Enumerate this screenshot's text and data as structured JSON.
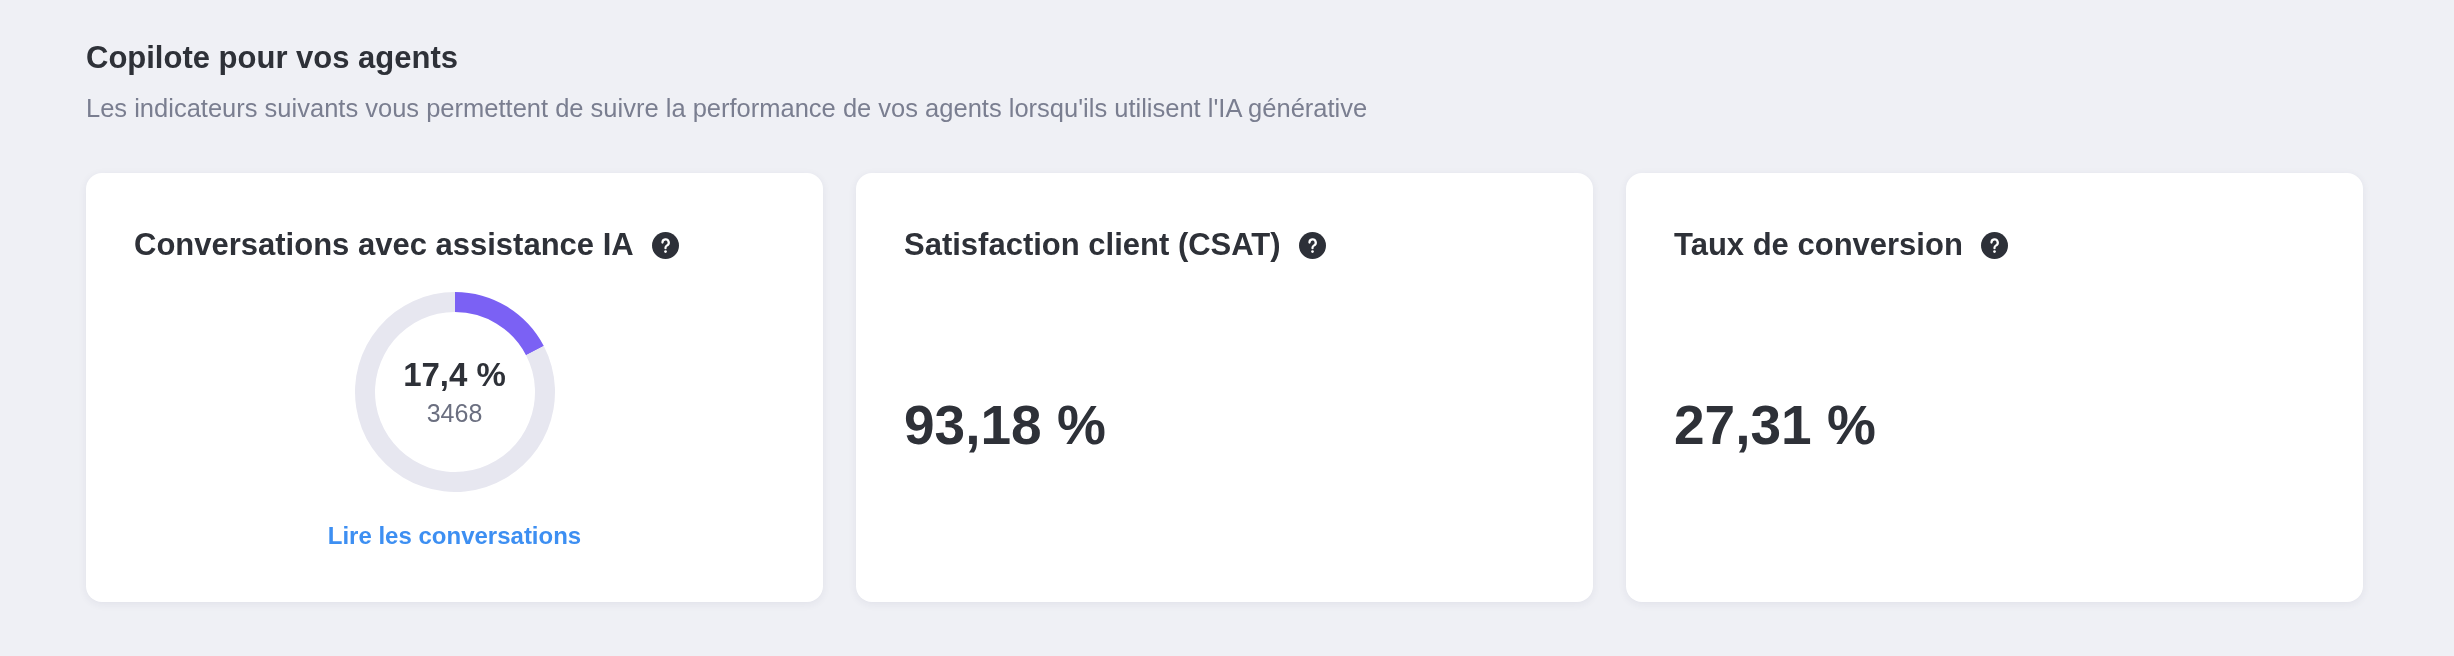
{
  "section": {
    "title": "Copilote pour vos agents",
    "description": "Les indicateurs suivants vous permettent de suivre la performance de vos agents lorsqu'ils utilisent l'IA générative"
  },
  "cards": [
    {
      "kind": "gauge",
      "title": "Conversations avec assistance IA",
      "gauge": {
        "chart_data": {
          "type": "donut",
          "values": [
            17.4,
            82.6
          ]
        },
        "percent": "17,4 %",
        "count": "3468"
      },
      "link": "Lire les conversations"
    },
    {
      "kind": "metric",
      "title": "Satisfaction client (CSAT)",
      "value": "93,18 %"
    },
    {
      "kind": "metric",
      "title": "Taux de conversion",
      "value": "27,31 %"
    }
  ]
}
